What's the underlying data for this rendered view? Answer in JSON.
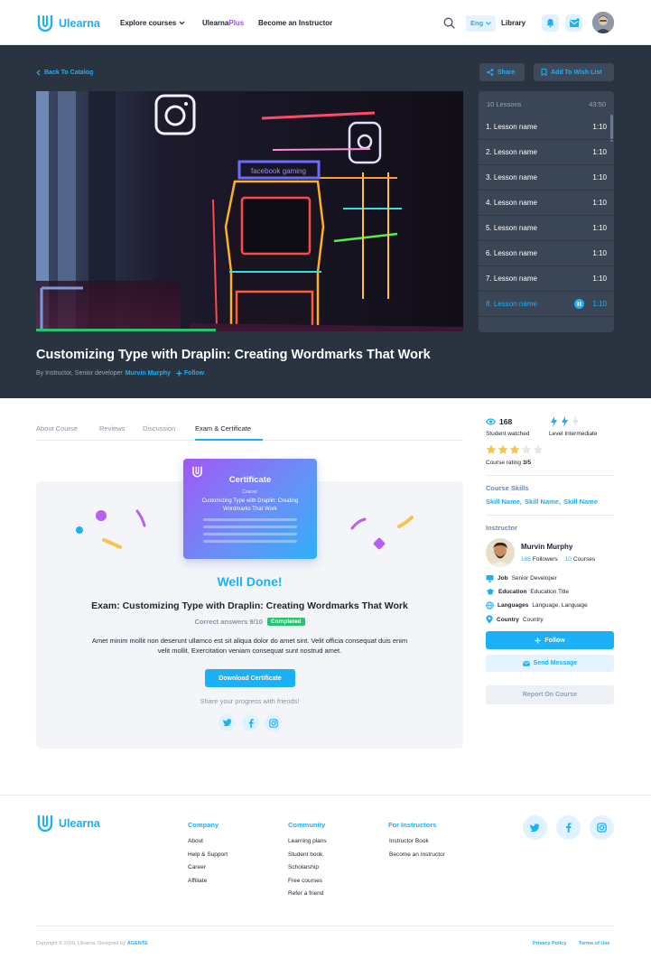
{
  "header": {
    "logo": "Ulearna",
    "nav": {
      "explore": "Explore courses",
      "plus_a": "Ulearna",
      "plus_b": "Plus",
      "become": "Become an Instructor"
    },
    "lang": "Eng",
    "library": "Library"
  },
  "hero": {
    "back": "Back To Catalog",
    "share": "Share",
    "wishlist": "Add To Wish List",
    "video_progress": 0.42,
    "title": "Customizing Type with Draplin: Creating Wordmarks That Work",
    "by_prefix": "By Instructor, Senior developer",
    "author": "Murvin Murphy",
    "follow": "Follow"
  },
  "lessons": {
    "count": "10 Lessons",
    "total": "43:50",
    "items": [
      {
        "name": "1. Lesson name",
        "time": "1:10"
      },
      {
        "name": "2. Lesson name",
        "time": "1:10"
      },
      {
        "name": "3. Lesson name",
        "time": "1:10"
      },
      {
        "name": "4. Lesson name",
        "time": "1:10"
      },
      {
        "name": "5. Lesson name",
        "time": "1:10"
      },
      {
        "name": "6. Lesson name",
        "time": "1:10"
      },
      {
        "name": "7. Lesson name",
        "time": "1:10"
      },
      {
        "name": "8. Lesson name",
        "time": "1:10"
      }
    ]
  },
  "tabs": [
    "About Course",
    "Reviews",
    "Discussion",
    "Exam & Certificate"
  ],
  "certificate": {
    "title": "Certificate",
    "course_label": "Course:",
    "course_name": "Customizing Type with Draplin: Creating Wordmarks That Work"
  },
  "exam": {
    "well_done": "Well Done!",
    "title": "Exam: Customizing Type with Draplin: Creating Wordmarks That Work",
    "correct": "Correct answers 9/10",
    "status": "Completed",
    "text_1": "Amet minim mollit non deserunt ullamco est sit aliqua dolor do amet sint. Velit officia consequat duis enim",
    "text_2": "velit mollit. Exercitation veniam consequat sunt nostrud amet.",
    "download": "Download Certificate",
    "share_text": "Share your progress with friends!"
  },
  "sidebar": {
    "watched": "168",
    "watched_label": "Student watched",
    "level_label": "Level Intermediate",
    "rating_label": "Course rating",
    "rating_value": "3/5",
    "rating": 3,
    "skills_head": "Course Skills",
    "skills": [
      "Skill Name,",
      "Skill Name,",
      "Skill Name"
    ],
    "instructor_head": "Instructor",
    "instructor_name": "Murvin Murphy",
    "followers_n": "168",
    "followers_label": "Followers",
    "courses_n": "10",
    "courses_label": "Courses",
    "job_k": "Job",
    "job_v": "Senior Developer",
    "edu_k": "Education",
    "edu_v": "Education Title",
    "lang_k": "Languages",
    "lang_v": "Language, Language",
    "country_k": "Country",
    "country_v": "Country",
    "follow_btn": "Follow",
    "message_btn": "Send Message",
    "report_btn": "Report On Course"
  },
  "footer": {
    "logo": "Ulearna",
    "company_head": "Company",
    "company": [
      "About",
      "Help & Support",
      "Career",
      "Affiliate"
    ],
    "community_head": "Community",
    "community": [
      "Learning plans",
      "Student book",
      "Scholarship",
      "Free courses",
      "Refer a friend"
    ],
    "instructors_head": "For Instructors",
    "instructors": [
      "Instructor Book",
      "Become an Instructor"
    ],
    "copyright": "Copyright © 2020, Ulearna. Designed by",
    "designer": "AGENTE",
    "privacy": "Privacy Policy",
    "terms": "Terms of Use"
  }
}
